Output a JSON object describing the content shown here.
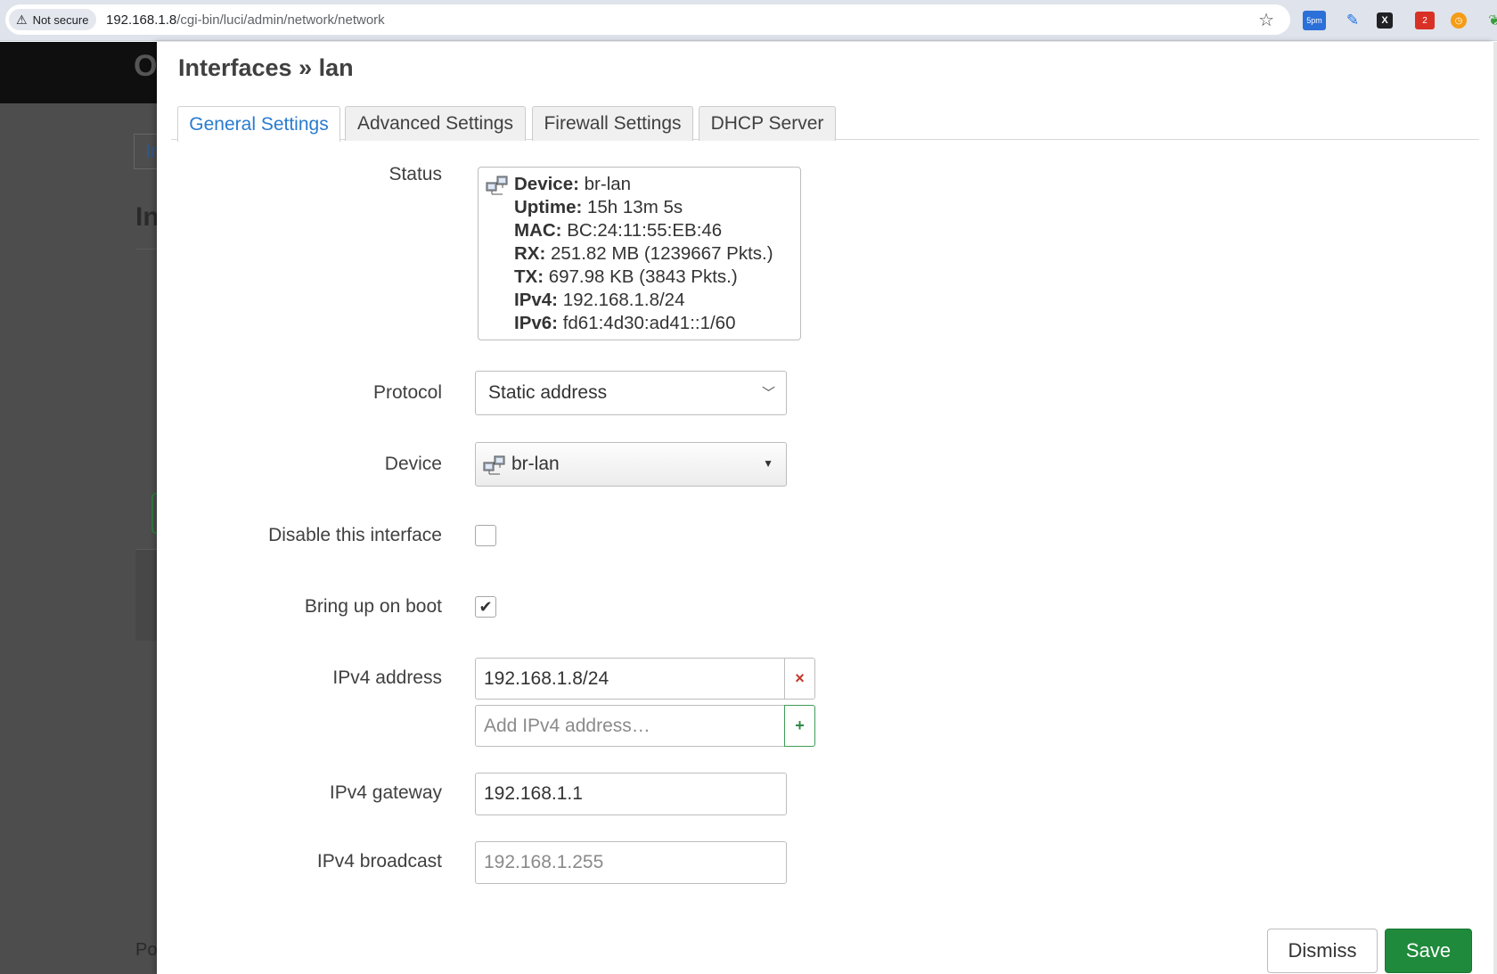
{
  "browser": {
    "security_label": "Not secure",
    "url_host": "192.168.1.8",
    "url_path": "/cgi-bin/luci/admin/network/network",
    "extensions": [
      {
        "name": "calendar-extension",
        "badge": "5pm"
      },
      {
        "name": "pen-extension"
      },
      {
        "name": "x-extension",
        "glyph": "X"
      },
      {
        "name": "notification-extension",
        "badge": "2"
      },
      {
        "name": "clock-extension"
      },
      {
        "name": "leaf-extension"
      }
    ]
  },
  "background_page": {
    "logo_char": "O",
    "tab_stub": "In",
    "heading_stub": "In",
    "footer_stub": "Po"
  },
  "modal": {
    "title": "Interfaces » lan",
    "tabs": [
      {
        "label": "General Settings",
        "active": true
      },
      {
        "label": "Advanced Settings",
        "active": false
      },
      {
        "label": "Firewall Settings",
        "active": false
      },
      {
        "label": "DHCP Server",
        "active": false
      }
    ],
    "status": {
      "label": "Status",
      "rows": [
        {
          "key": "Device:",
          "value": " br-lan"
        },
        {
          "key": "Uptime:",
          "value": " 15h 13m 5s"
        },
        {
          "key": "MAC:",
          "value": " BC:24:11:55:EB:46"
        },
        {
          "key": "RX:",
          "value": " 251.82 MB (1239667 Pkts.)"
        },
        {
          "key": "TX:",
          "value": " 697.98 KB (3843 Pkts.)"
        },
        {
          "key": "IPv4:",
          "value": " 192.168.1.8/24"
        },
        {
          "key": "IPv6:",
          "value": " fd61:4d30:ad41::1/60"
        }
      ]
    },
    "protocol": {
      "label": "Protocol",
      "value": "Static address"
    },
    "device": {
      "label": "Device",
      "value": "br-lan"
    },
    "disable_interface": {
      "label": "Disable this interface",
      "checked": false
    },
    "bring_up_on_boot": {
      "label": "Bring up on boot",
      "checked": true,
      "check_glyph": "✔"
    },
    "ipv4_address": {
      "label": "IPv4 address",
      "values": [
        "192.168.1.8/24"
      ],
      "add_placeholder": "Add IPv4 address…",
      "remove_glyph": "×",
      "add_glyph": "+"
    },
    "ipv4_gateway": {
      "label": "IPv4 gateway",
      "value": "192.168.1.1"
    },
    "ipv4_broadcast": {
      "label": "IPv4 broadcast",
      "placeholder": "192.168.1.255"
    },
    "buttons": {
      "dismiss": "Dismiss",
      "save": "Save"
    }
  },
  "colors": {
    "active_tab_text": "#2a7bd0",
    "save_button": "#1f8a3b",
    "remove_icon": "#c0392b",
    "add_icon": "#2f8a46",
    "overlay": "#4d4d4d"
  }
}
